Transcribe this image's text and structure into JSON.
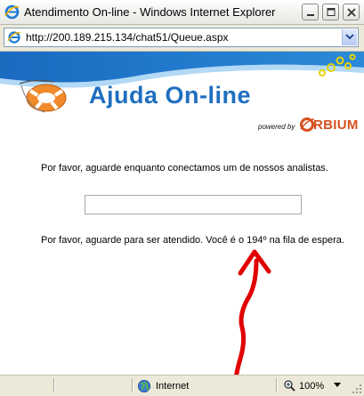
{
  "window": {
    "title": "Atendimento On-line - Windows Internet Explorer"
  },
  "address": {
    "url": "http://200.189.215.134/chat51/Queue.aspx"
  },
  "banner": {
    "title": "Ajuda On-line",
    "powered_by": "powered by",
    "brand": "RBIUM"
  },
  "page": {
    "wait_message": "Por favor, aguarde enquanto conectamos um de nossos analistas.",
    "queue_message": "Por favor, aguarde para ser atendido. Você é o 194º na fila de espera.",
    "progress": 0
  },
  "status": {
    "zone": "Internet",
    "zoom": "100%"
  },
  "colors": {
    "brand_blue": "#1f6fbf",
    "orbium_orange": "#d6501f",
    "annotation_red": "#e00000"
  }
}
